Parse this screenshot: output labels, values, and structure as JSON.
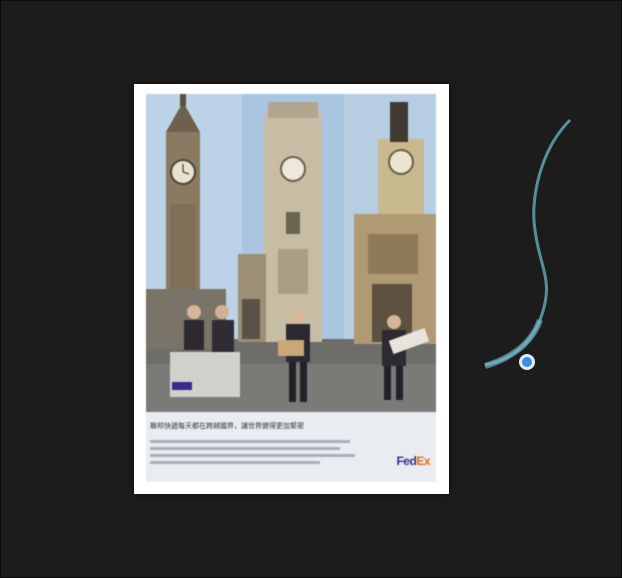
{
  "viewer": {
    "background_color": "#1c1c1c",
    "image_description_label": ""
  },
  "ad": {
    "headline": "聯邦快遞每天都在跨越國界，讓世界變得更加緊密",
    "brand_logo_text_a": "Fed",
    "brand_logo_text_b": "Ex",
    "brand_colors": {
      "purple": "#3b2a8a",
      "orange": "#e0701a"
    }
  },
  "cursor": {
    "icon": "drag-cursor-icon",
    "trail_color": "#4f9db0",
    "dot_color": "#3a8fdc"
  }
}
